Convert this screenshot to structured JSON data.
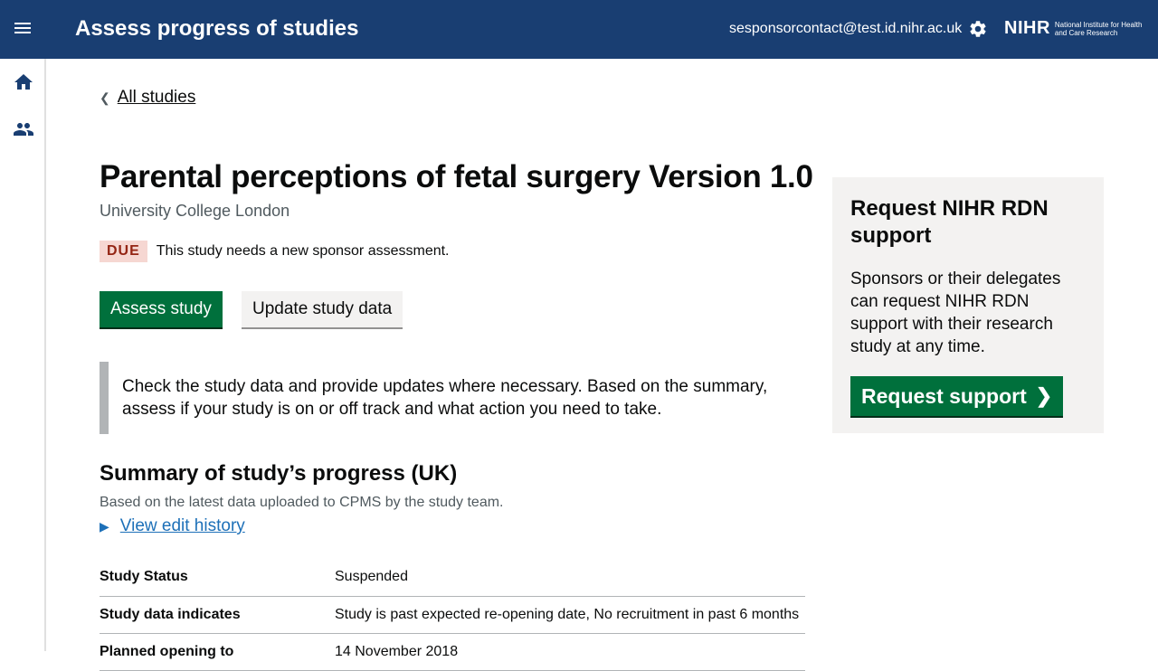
{
  "header": {
    "app_title": "Assess progress of studies",
    "user_email": "sesponsorcontact@test.id.nihr.ac.uk",
    "logo_text": "NIHR",
    "logo_subtext": "National Institute for Health and Care Research"
  },
  "main": {
    "back_link": "All studies",
    "study_title": "Parental perceptions of fetal surgery Version 1.0",
    "organisation": "University College London",
    "due_badge": "DUE",
    "due_text": "This study needs a new sponsor assessment.",
    "assess_button": "Assess study",
    "update_button": "Update study data",
    "inset_text": "Check the study data and provide updates where necessary. Based on the summary, assess if your study is on or off track and what action you need to take.",
    "summary_title": "Summary of study’s progress (UK)",
    "summary_subtitle": "Based on the latest data uploaded to CPMS by the study team.",
    "history_link": "View edit history",
    "summary_rows": [
      {
        "key": "Study Status",
        "value": "Suspended"
      },
      {
        "key": "Study data indicates",
        "value": "Study is past expected re-opening date, No recruitment in past 6 months"
      },
      {
        "key": "Planned opening to",
        "value": "14 November 2018"
      }
    ]
  },
  "panel": {
    "title": "Request NIHR RDN support",
    "body": "Sponsors or their delegates can request NIHR RDN support with their research study at any time.",
    "button": "Request support"
  },
  "colors": {
    "header_bg": "#193e72",
    "primary_green": "#00703c",
    "due_bg": "#f6d7d2",
    "due_text": "#942514",
    "link_blue": "#1d70b8"
  }
}
